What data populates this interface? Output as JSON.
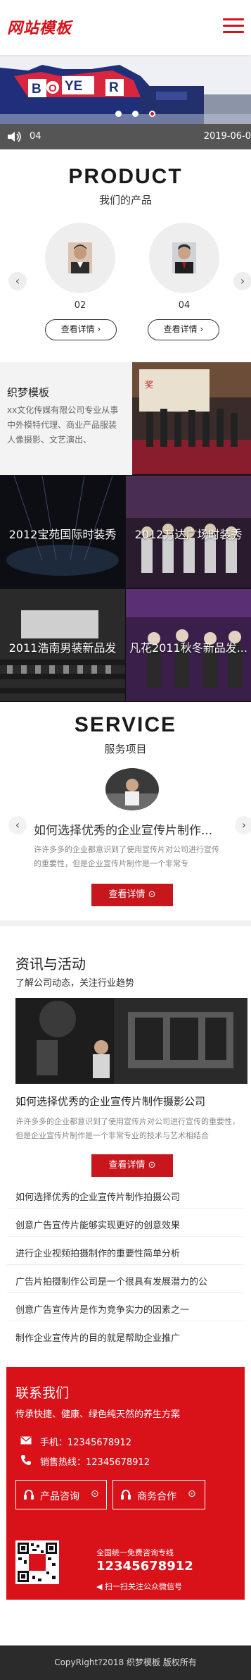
{
  "header": {
    "logo_text": "网站模板"
  },
  "banner": {
    "sign_text": "BOYER"
  },
  "ticker": {
    "number": "04",
    "date": "2019-06-0"
  },
  "product": {
    "title_en": "PRODUCT",
    "title_cn": "我们的产品",
    "items": [
      {
        "number": "02",
        "button": "查看详情"
      },
      {
        "number": "04",
        "button": "查看详情"
      }
    ]
  },
  "about": {
    "title": "织梦模板",
    "text": "xx文化传媒有限公司专业从事中外模特代理、商业产品服装人像摄影、文艺演出、"
  },
  "cases": [
    {
      "label": "2012宝苑国际时装秀"
    },
    {
      "label": "2012万达广场时装秀"
    },
    {
      "label": "2011浩南男装新品发"
    },
    {
      "label": "凡花2011秋冬新品发..."
    }
  ],
  "service": {
    "title_en": "SERVICE",
    "title_cn": "服务项目",
    "headline": "如何选择优秀的企业宣传片制作...",
    "desc": "许许多多的企业都意识到了使用宣传片对公司进行宣传的重要性，但是企业宣传片制作是一个非常专",
    "button": "查看详情"
  },
  "news": {
    "title": "资讯与活动",
    "subtitle": "了解公司动态，关注行业趋势",
    "featured_title": "如何选择优秀的企业宣传片制作摄影公司",
    "featured_desc": "许许多多的企业都意识到了使用宣传片对公司进行宣传的重要性，但是企业宣传片制作是一个非常专业的技术与艺术相结合",
    "button": "查看详情",
    "list": [
      "如何选择优秀的企业宣传片制作拍摄公司",
      "创意广告宣传片能够实现更好的创意效果",
      "进行企业视频拍摄制作的重要性简单分析",
      "广告片拍摄制作公司是一个很具有发展潜力的公",
      "创意广告宣传片是作为竞争实力的因素之一",
      "制作企业宣传片的目的就是帮助企业推广"
    ]
  },
  "contact": {
    "title": "联系我们",
    "slogan": "传承快捷、健康、绿色纯天然的养生方案",
    "phone": "手机：12345678912",
    "hotline": "销售热线：12345678912",
    "btn_product": "产品咨询",
    "btn_business": "商务合作",
    "consult_label": "全国统一免费咨询专线",
    "consult_number": "12345678912",
    "wechat": "扫一扫关注公众微信号"
  },
  "footer": {
    "copyright": "CopyRight?2018 织梦模板 版权所有"
  },
  "colors": {
    "accent": "#d4141c",
    "dark": "#2b2b2b"
  }
}
